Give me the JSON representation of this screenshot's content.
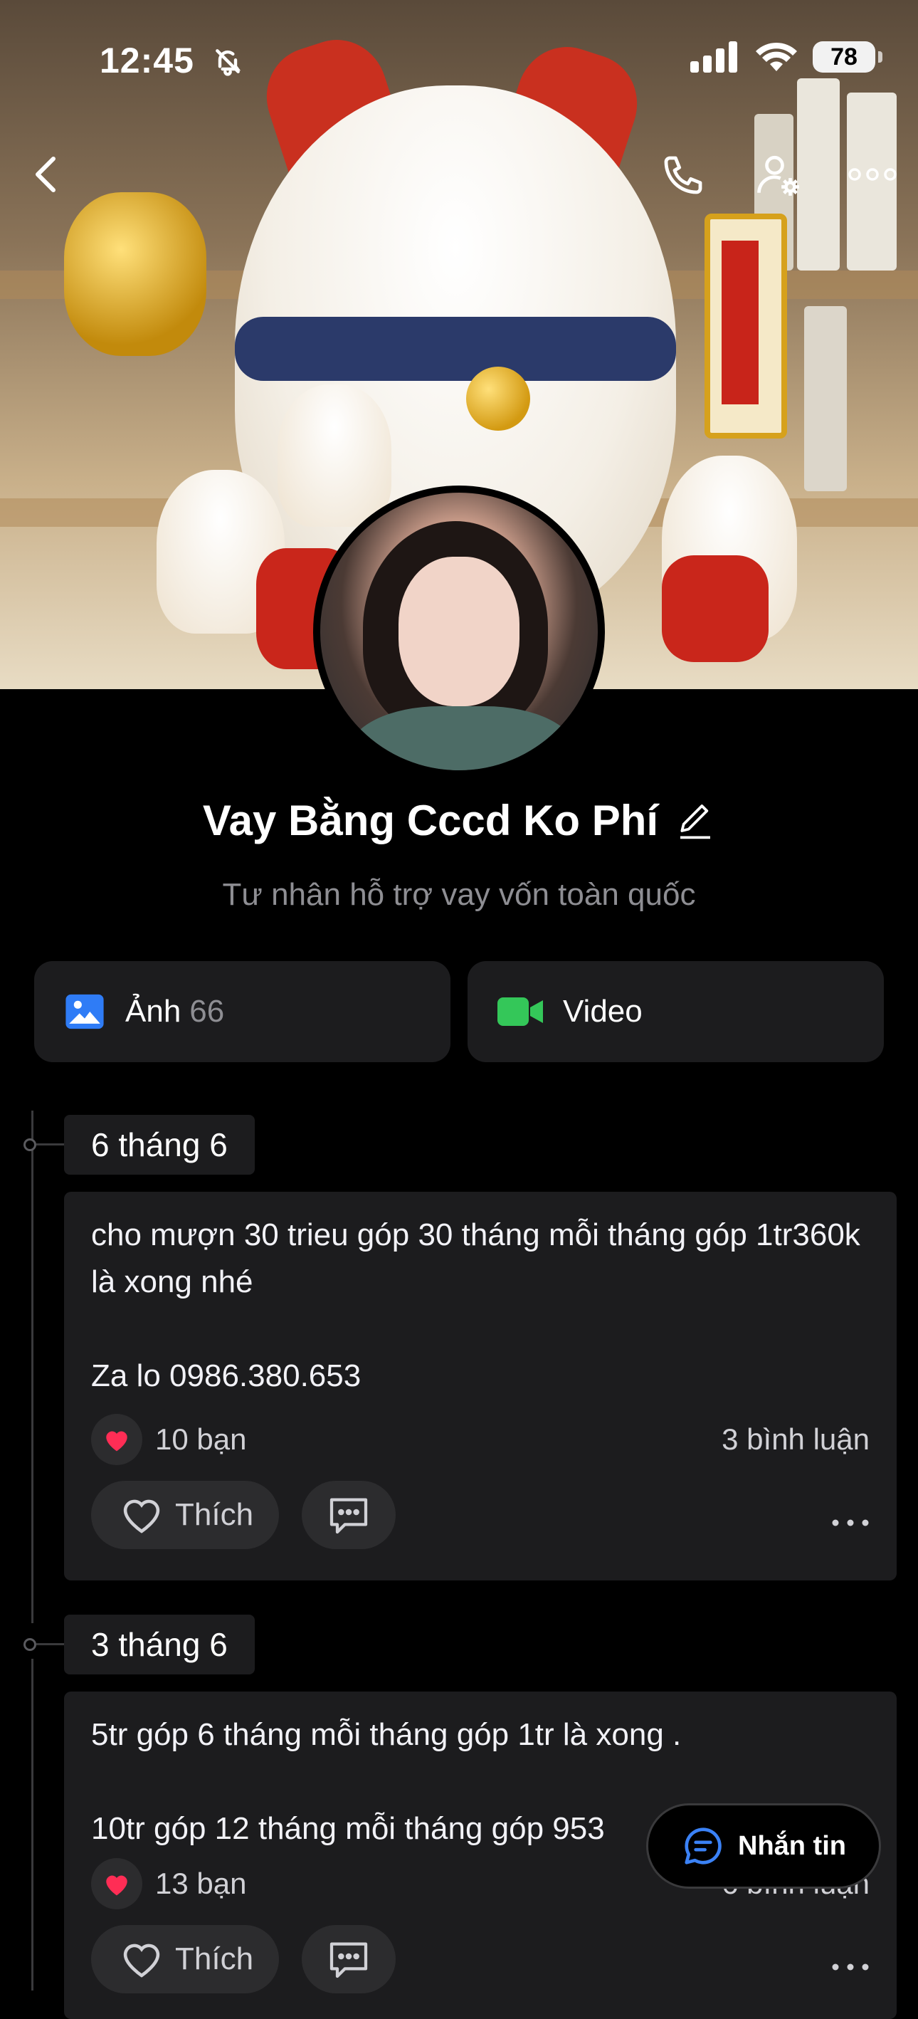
{
  "status_bar": {
    "time": "12:45",
    "battery": "78"
  },
  "profile": {
    "name": "Vay Bằng Cccd Ko Phí",
    "bio": "Tư nhân hỗ trợ vay vốn toàn quốc"
  },
  "media": {
    "photos_label": "Ảnh",
    "photos_count": "66",
    "video_label": "Video"
  },
  "posts": [
    {
      "date": "6 tháng 6",
      "text": "cho mượn 30 trieu góp 30 tháng mỗi tháng góp 1tr360k là xong nhé\n\nZa lo 0986.380.653",
      "reactions": "10 bạn",
      "comments": "3 bình luận",
      "like_label": "Thích"
    },
    {
      "date": "3 tháng 6",
      "text": "5tr góp 6 tháng mỗi tháng góp 1tr là xong .\n\n10tr góp 12 tháng mỗi tháng góp 953",
      "reactions": "13 bạn",
      "comments": "6 bình luận",
      "like_label": "Thích"
    }
  ],
  "floating_message": {
    "label": "Nhắn tin"
  },
  "colors": {
    "background": "#000000",
    "card": "#1c1c1e",
    "photo_icon": "#2f7cf6",
    "video_icon": "#34c759",
    "heart": "#ff2d55",
    "chat_icon": "#3b82f6"
  }
}
